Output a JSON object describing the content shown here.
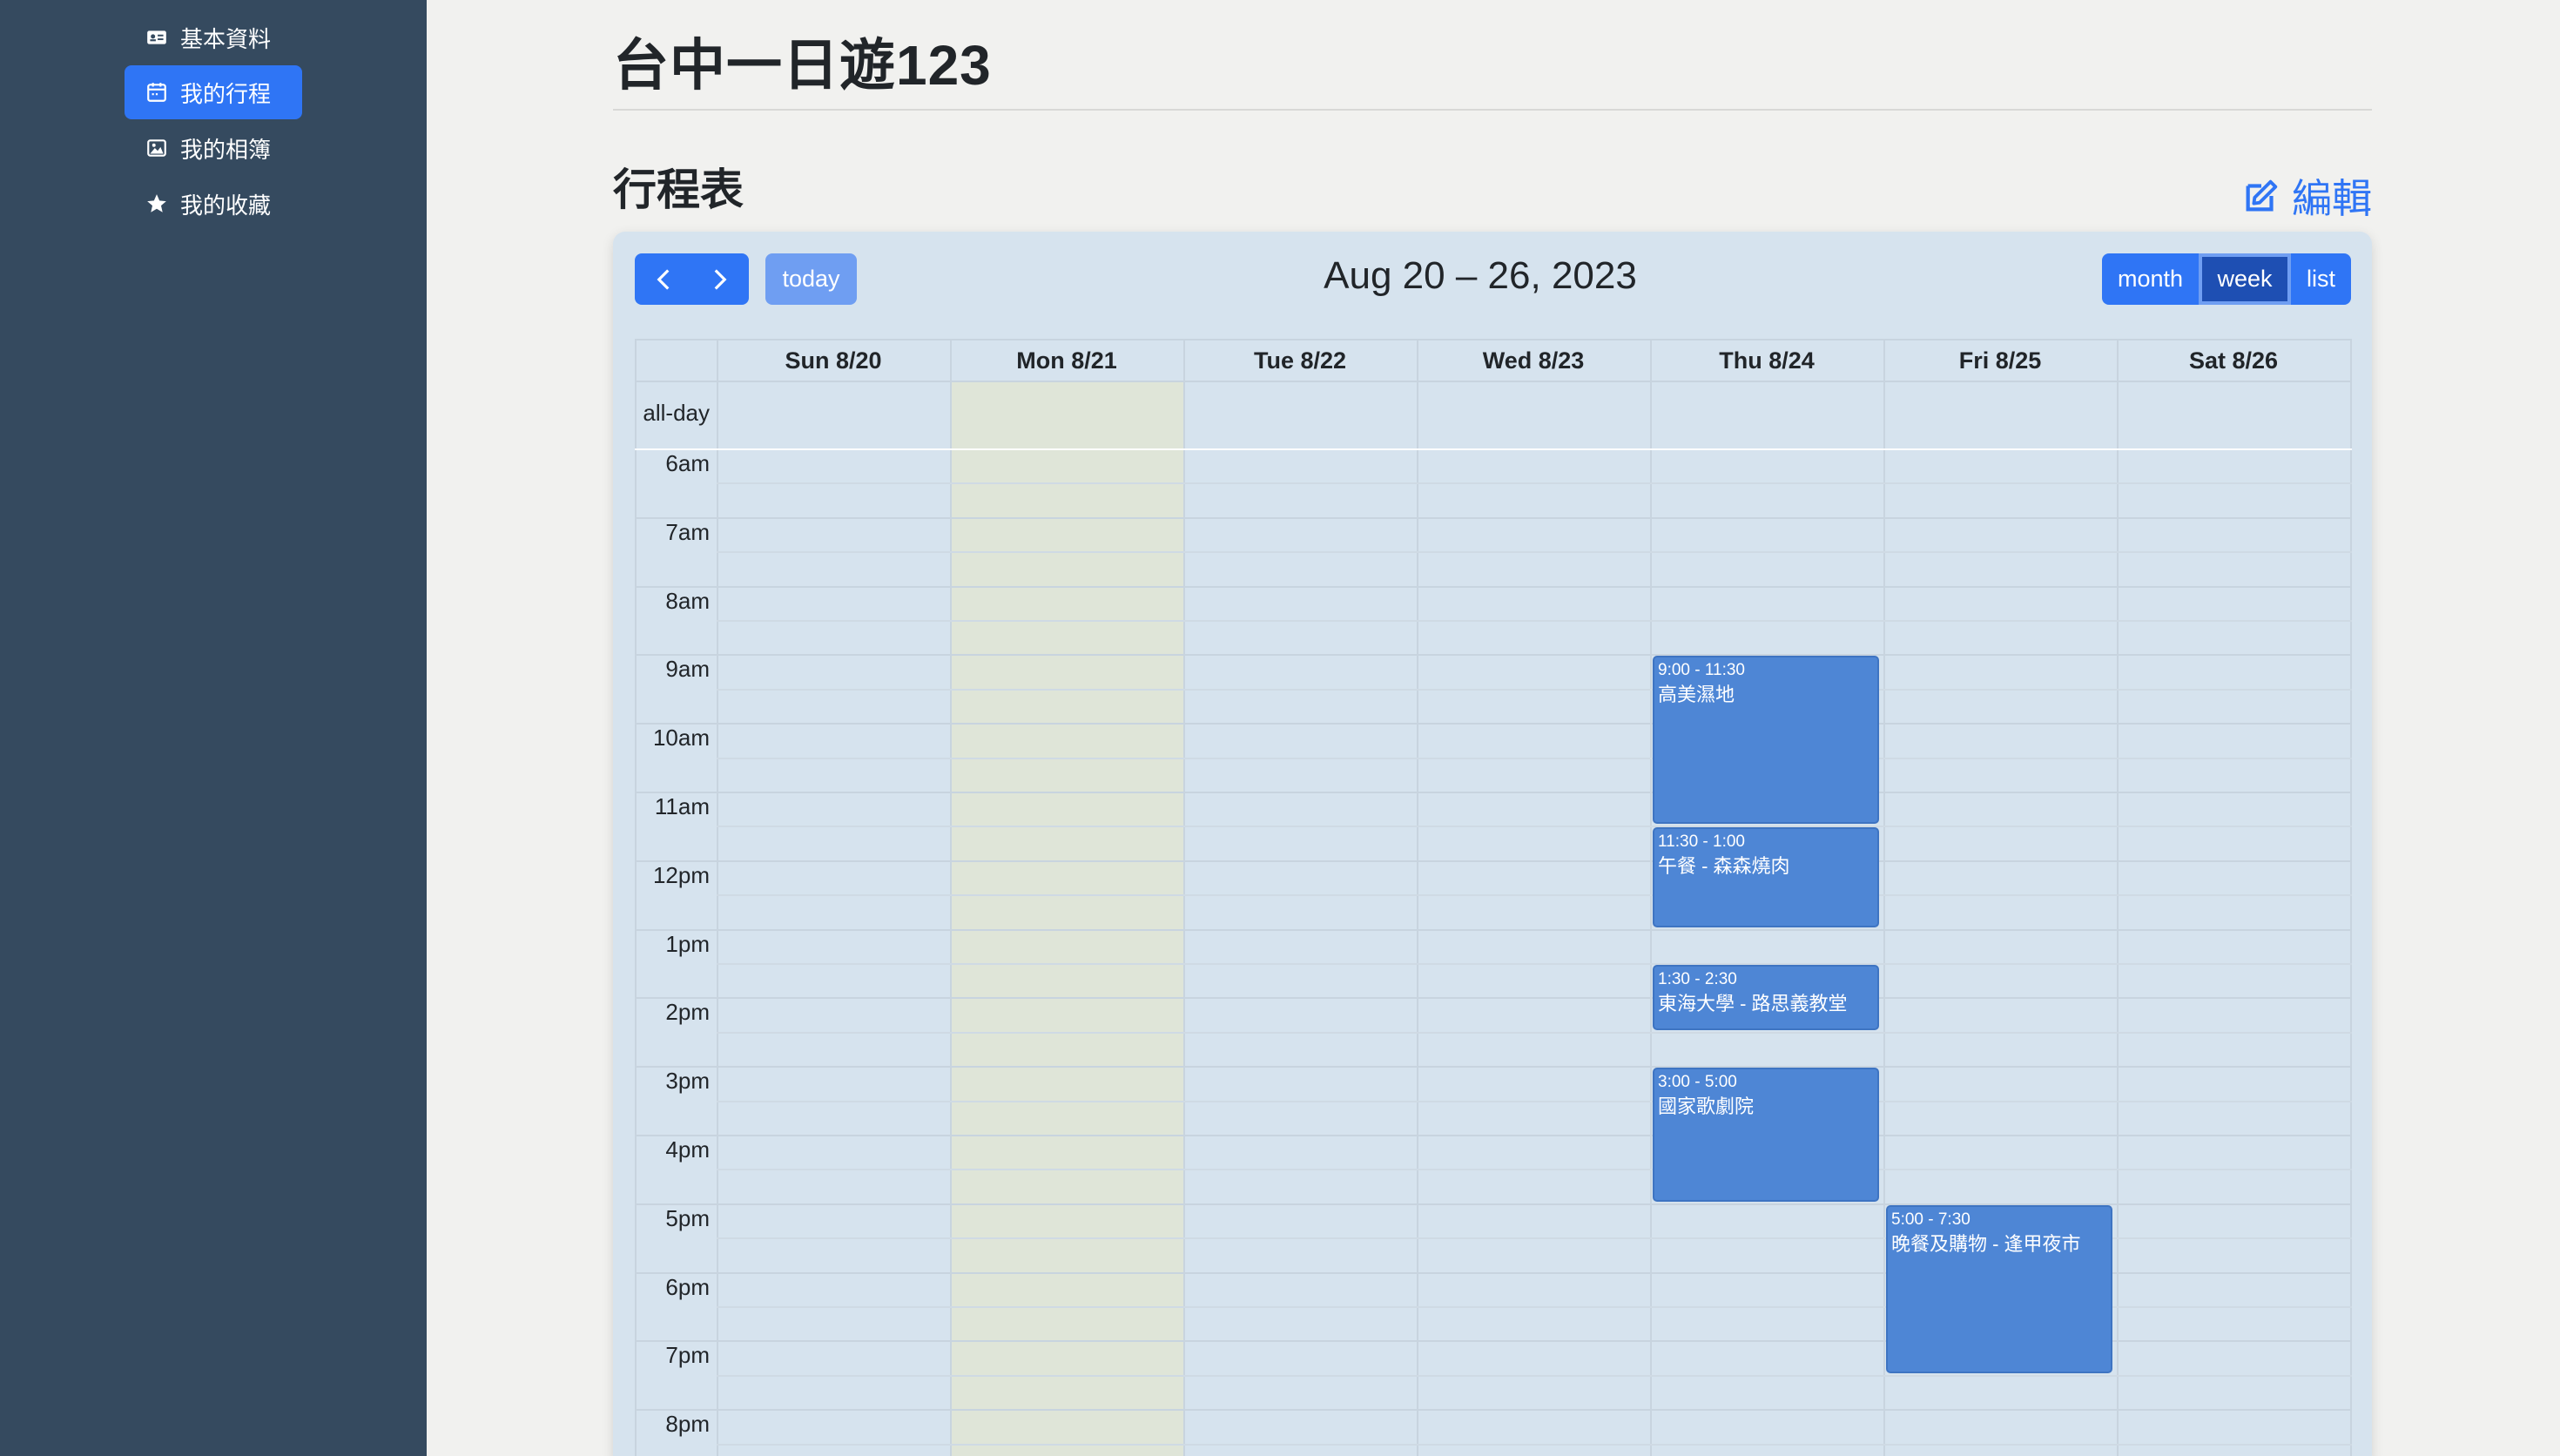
{
  "sidebar": {
    "items": [
      {
        "label": "基本資料",
        "icon": "id-card-icon"
      },
      {
        "label": "我的行程",
        "icon": "calendar-icon",
        "active": true
      },
      {
        "label": "我的相簿",
        "icon": "image-icon"
      },
      {
        "label": "我的收藏",
        "icon": "star-icon"
      }
    ]
  },
  "page": {
    "title": "台中一日遊123",
    "section_title": "行程表",
    "edit_label": "編輯"
  },
  "calendar": {
    "today_label": "today",
    "range_title": "Aug 20 – 26, 2023",
    "views": [
      "month",
      "week",
      "list"
    ],
    "active_view": "week",
    "all_day_label": "all-day",
    "days": [
      "Sun 8/20",
      "Mon 8/21",
      "Tue 8/22",
      "Wed 8/23",
      "Thu 8/24",
      "Fri 8/25",
      "Sat 8/26"
    ],
    "today_index": 1,
    "time_labels": [
      "6am",
      "7am",
      "8am",
      "9am",
      "10am",
      "11am",
      "12pm",
      "1pm",
      "2pm",
      "3pm",
      "4pm",
      "5pm",
      "6pm",
      "7pm",
      "8pm"
    ],
    "events": [
      {
        "day": 4,
        "start": 9.0,
        "end": 11.5,
        "time": "9:00 - 11:30",
        "title": "高美濕地"
      },
      {
        "day": 4,
        "start": 11.5,
        "end": 13.0,
        "time": "11:30 - 1:00",
        "title": "午餐 - 森森燒肉"
      },
      {
        "day": 4,
        "start": 13.5,
        "end": 14.5,
        "time": "1:30 - 2:30",
        "title": "東海大學 - 路思義教堂"
      },
      {
        "day": 4,
        "start": 15.0,
        "end": 17.0,
        "time": "3:00 - 5:00",
        "title": "國家歌劇院"
      },
      {
        "day": 5,
        "start": 17.0,
        "end": 19.5,
        "time": "5:00 - 7:30",
        "title": "晚餐及購物 - 逢甲夜市"
      }
    ]
  },
  "colors": {
    "sidebar_bg": "#354a5f",
    "accent": "#2f75f5",
    "event_bg": "#4e86d5",
    "today_highlight": "#dfe5d8"
  }
}
